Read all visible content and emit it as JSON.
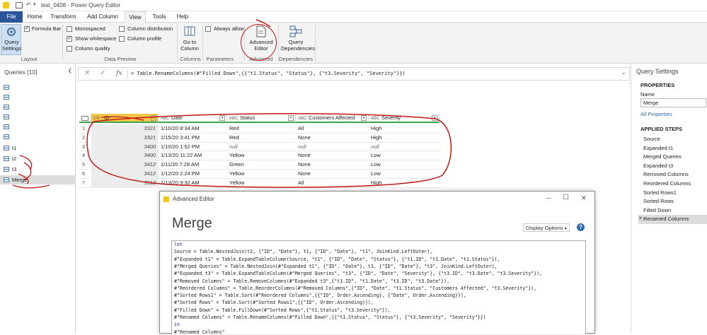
{
  "window": {
    "title": "test_0408 - Power Query Editor"
  },
  "tabs": [
    "File",
    "Home",
    "Transform",
    "Add Column",
    "View",
    "Tools",
    "Help"
  ],
  "ribbon": {
    "query_settings": "Query Settings",
    "formula_bar": "Formula Bar",
    "layout_group": "Layout",
    "monospaced": "Monospaced",
    "show_whitespace": "Show whitespace",
    "column_quality": "Column quality",
    "column_distribution": "Column distribution",
    "column_profile": "Column profile",
    "data_preview_group": "Data Preview",
    "go_to_column": "Go to Column",
    "columns_group": "Columns",
    "always_allow": "Always allow",
    "parameters_group": "Parameters",
    "advanced_editor": "Advanced Editor",
    "advanced_group": "Advanced",
    "query_dependencies": "Query Dependencies",
    "dependencies_group": "Dependencies"
  },
  "queries_pane": {
    "title": "Queries [10]",
    "collapse_glyph": "❮",
    "items": [
      {
        "label": ""
      },
      {
        "label": ""
      },
      {
        "label": ""
      },
      {
        "label": ""
      },
      {
        "label": ""
      },
      {
        "label": ""
      },
      {
        "label": "t1"
      },
      {
        "label": "t2"
      },
      {
        "label": "t3"
      },
      {
        "label": "Merge"
      }
    ]
  },
  "formula_bar": {
    "cancel_glyph": "✕",
    "commit_glyph": "✓",
    "fx_glyph": "fx",
    "formula": "= Table.RenameColumns(#\"Filled Down\",{{\"t1.Status\", \"Status\"}, {\"t3.Severity\", \"Severity\"}})",
    "expand_glyph": "⌄"
  },
  "grid": {
    "headers": [
      {
        "type": "1²3",
        "name": "ID"
      },
      {
        "type": "ABC",
        "name": "Date"
      },
      {
        "type": "ABC",
        "name": "Status"
      },
      {
        "type": "ABC",
        "name": "Customers Affected"
      },
      {
        "type": "ABC",
        "name": "Severity"
      }
    ],
    "dropdown_glyph": "▾",
    "rows": [
      {
        "n": "1",
        "id": "3321",
        "date": "1/10/20 8:34 AM",
        "status": "Red",
        "customers": "All",
        "severity": "High"
      },
      {
        "n": "2",
        "id": "3321",
        "date": "1/15/20 3:41 PM",
        "status": "Red",
        "customers": "None",
        "severity": "High"
      },
      {
        "n": "3",
        "id": "3400",
        "date": "1/10/20 1:52 PM",
        "status": "null",
        "customers": "null",
        "severity": "null"
      },
      {
        "n": "4",
        "id": "3400",
        "date": "1/13/20 11:22 AM",
        "status": "Yellow",
        "customers": "None",
        "severity": "Low"
      },
      {
        "n": "5",
        "id": "3412",
        "date": "1/11/20 7:28 AM",
        "status": "Green",
        "customers": "None",
        "severity": "Low"
      },
      {
        "n": "6",
        "id": "3412",
        "date": "1/12/20 2:24 PM",
        "status": "Yellow",
        "customers": "None",
        "severity": "Low"
      },
      {
        "n": "7",
        "id": "3512",
        "date": "1/13/20 9:32 AM",
        "status": "Yellow",
        "customers": "All",
        "severity": "High"
      }
    ]
  },
  "settings_pane": {
    "title": "Query Settings",
    "properties": "PROPERTIES",
    "name_label": "Name",
    "name_value": "Merge",
    "all_properties": "All Properties",
    "applied_steps": "APPLIED STEPS",
    "steps": [
      "Source",
      "Expanded t1",
      "Merged Queries",
      "Expanded t3",
      "Removed Columns",
      "Reordered Columns",
      "Sorted Rows1",
      "Sorted Rows",
      "Filled Down",
      "Renamed Columns"
    ],
    "close_glyph": "✕"
  },
  "advanced_editor": {
    "window_title": "Advanced Editor",
    "heading": "Merge",
    "display_options": "Display Options",
    "help_glyph": "?",
    "minimize_glyph": "—",
    "maximize_glyph": "☐",
    "close_glyph": "✕",
    "code": [
      "let",
      "    Source = Table.NestedJoin(t2, {\"ID\", \"Date\"}, t1, {\"ID\", \"Date\"}, \"t1\", JoinKind.LeftOuter),",
      "    #\"Expanded t1\" = Table.ExpandTableColumn(Source, \"t1\", {\"ID\", \"Date\", \"Status\"}, {\"t1.ID\", \"t1.Date\", \"t1.Status\"}),",
      "    #\"Merged Queries\" = Table.NestedJoin(#\"Expanded t1\", {\"ID\", \"Date\"}, t3, {\"ID\", \"Date\"}, \"t3\", JoinKind.LeftOuter),",
      "    #\"Expanded t3\" = Table.ExpandTableColumn(#\"Merged Queries\", \"t3\", {\"ID\", \"Date\", \"Severity\"}, {\"t3.ID\", \"t3.Date\", \"t3.Severity\"}),",
      "    #\"Removed Columns\" = Table.RemoveColumns(#\"Expanded t3\",{\"t1.ID\", \"t1.Date\", \"t3.ID\", \"t3.Date\"}),",
      "    #\"Reordered Columns\" = Table.ReorderColumns(#\"Removed Columns\",{\"ID\", \"Date\", \"t1.Status\", \"Customers Affected\", \"t3.Severity\"}),",
      "    #\"Sorted Rows1\" = Table.Sort(#\"Reordered Columns\",{{\"ID\", Order.Ascending}, {\"Date\", Order.Ascending}}),",
      "    #\"Sorted Rows\" = Table.Sort(#\"Sorted Rows1\",{{\"ID\", Order.Ascending}}),",
      "    #\"Filled Down\" = Table.FillDown(#\"Sorted Rows\",{\"t1.Status\", \"t3.Severity\"}),",
      "    #\"Renamed Columns\" = Table.RenameColumns(#\"Filled Down\",{{\"t1.Status\", \"Status\"}, {\"t3.Severity\", \"Severity\"}})",
      "in",
      "    #\"Renamed Columns\""
    ]
  },
  "colors": {
    "file_tab": "#2b579a",
    "accent_green": "#3ca34b",
    "selection": "#f3c64a",
    "annotation": "#c01818"
  }
}
